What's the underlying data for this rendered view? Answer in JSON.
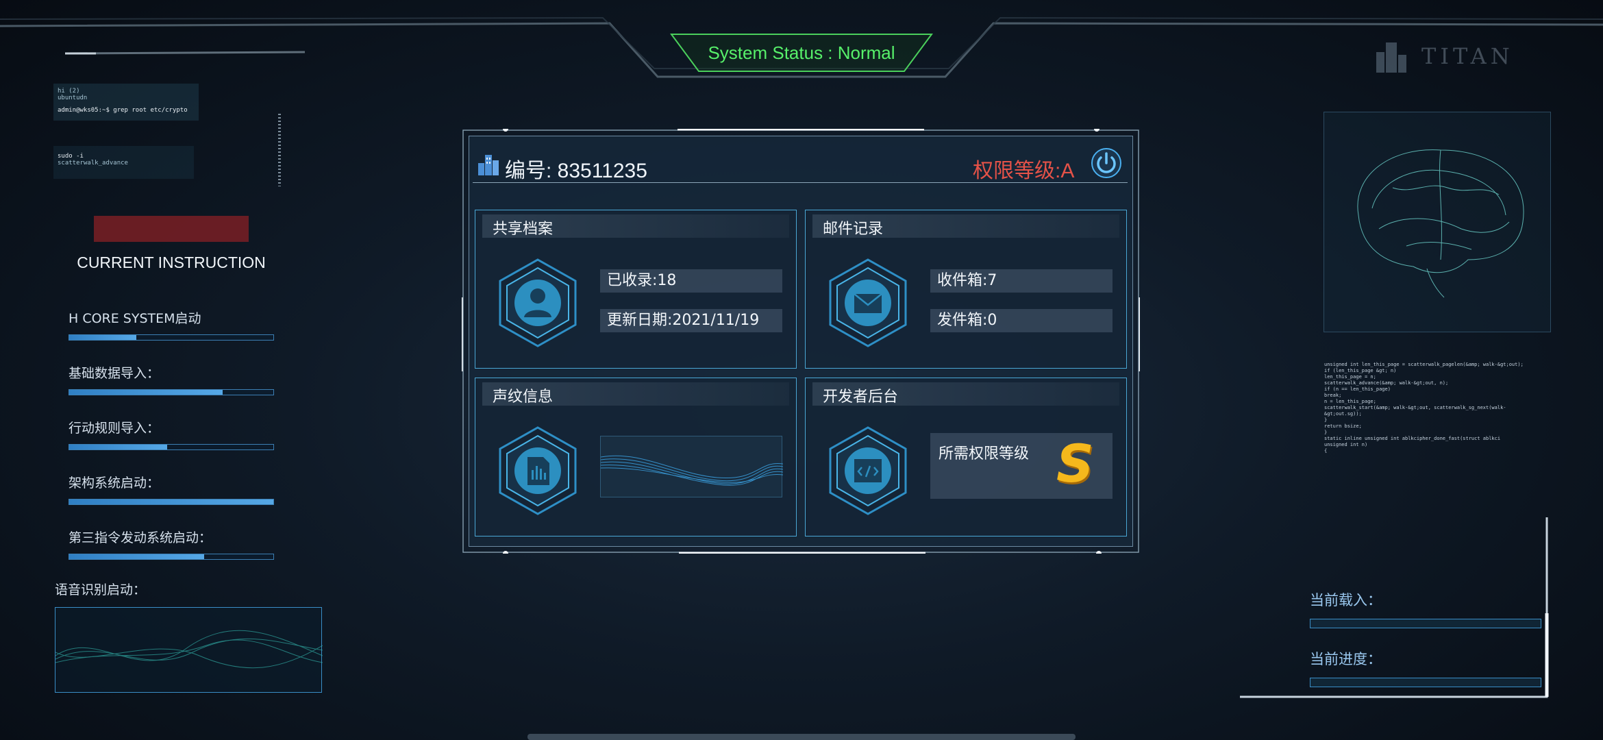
{
  "system_status": "System Status : Normal",
  "logo": {
    "text": "TITAN"
  },
  "terminal": {
    "line1": "hi (2)",
    "line2": "ubuntudn",
    "line3": "admin@wks05:~$ grep root etc/crypto",
    "line4": "sudo -i",
    "line5": "scatterwalk_advance"
  },
  "left": {
    "current_instruction": "CURRENT INSTRUCTION",
    "tasks": [
      {
        "label": "H CORE SYSTEM启动",
        "progress": 0.33
      },
      {
        "label": "基础数据导入：",
        "progress": 0.75
      },
      {
        "label": "行动规则导入：",
        "progress": 0.48
      },
      {
        "label": "架构系统启动：",
        "progress": 1.0
      },
      {
        "label": "第三指令发动系统启动：",
        "progress": 0.66
      }
    ],
    "voice_label": "语音识别启动："
  },
  "panel": {
    "id_text": "编号: 83511235",
    "permission": "权限等级:A",
    "cards": {
      "files": {
        "title": "共享档案",
        "collected": "已收录:18",
        "updated": "更新日期:2021/11/19"
      },
      "mail": {
        "title": "邮件记录",
        "inbox": "收件箱:7",
        "outbox": "发件箱:0"
      },
      "voiceprint": {
        "title": "声纹信息"
      },
      "developer": {
        "title": "开发者后台",
        "required_label": "所需权限等级",
        "required_level": "S"
      }
    }
  },
  "right": {
    "code_lines": [
      "unsigned int len_this_page = scatterwalk_pagelen(&amp; walk-&gt;out);",
      "if (len_this_page &gt; n)",
      "len_this_page = n;",
      "scatterwalk_advance(&amp; walk-&gt;out, n);",
      "if (n == len_this_page)",
      "break;",
      "n = len_this_page;",
      "scatterwalk_start(&amp; walk-&gt;out, scatterwalk_sg_next(walk-&gt;out.sg));",
      "}",
      "return bsize;",
      "}",
      "static inline unsigned int ablkcipher_done_fast(struct ablkci",
      "unsigned int n)",
      "{"
    ],
    "load_label": "当前载入：",
    "progress_label": "当前进度："
  },
  "colors": {
    "accent": "#4aa8d6",
    "status_green": "#57f06a",
    "permission_red": "#e55248",
    "gold": "#f5b81c"
  }
}
